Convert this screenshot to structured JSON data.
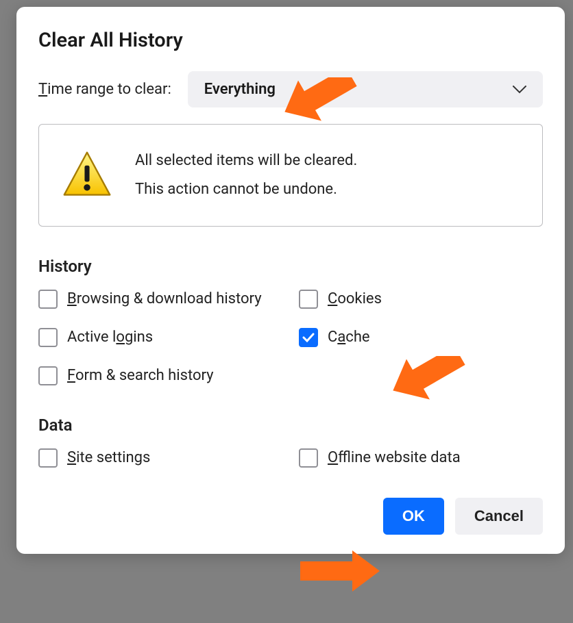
{
  "dialog": {
    "title": "Clear All History",
    "time_label_pre": "T",
    "time_label_post": "ime range to clear:",
    "time_value": "Everything",
    "warning_line1": "All selected items will be cleared.",
    "warning_line2": "This action cannot be undone."
  },
  "history": {
    "title": "History",
    "items": [
      {
        "pre": "B",
        "post": "rowsing & download history",
        "checked": false
      },
      {
        "pre": "C",
        "post": "ookies",
        "checked": false
      },
      {
        "pre": "Active l",
        "mid": "o",
        "post": "gins",
        "checked": false,
        "midUnderline": true
      },
      {
        "pre": "C",
        "mid": "a",
        "post": "che",
        "checked": true,
        "midUnderline": true
      },
      {
        "pre": "F",
        "post": "orm & search history",
        "checked": false
      }
    ]
  },
  "data_sec": {
    "title": "Data",
    "items": [
      {
        "pre": "S",
        "post": "ite settings",
        "checked": false
      },
      {
        "pre": "O",
        "post": "ffline website data",
        "checked": false
      }
    ]
  },
  "buttons": {
    "ok": "OK",
    "cancel": "Cancel"
  }
}
